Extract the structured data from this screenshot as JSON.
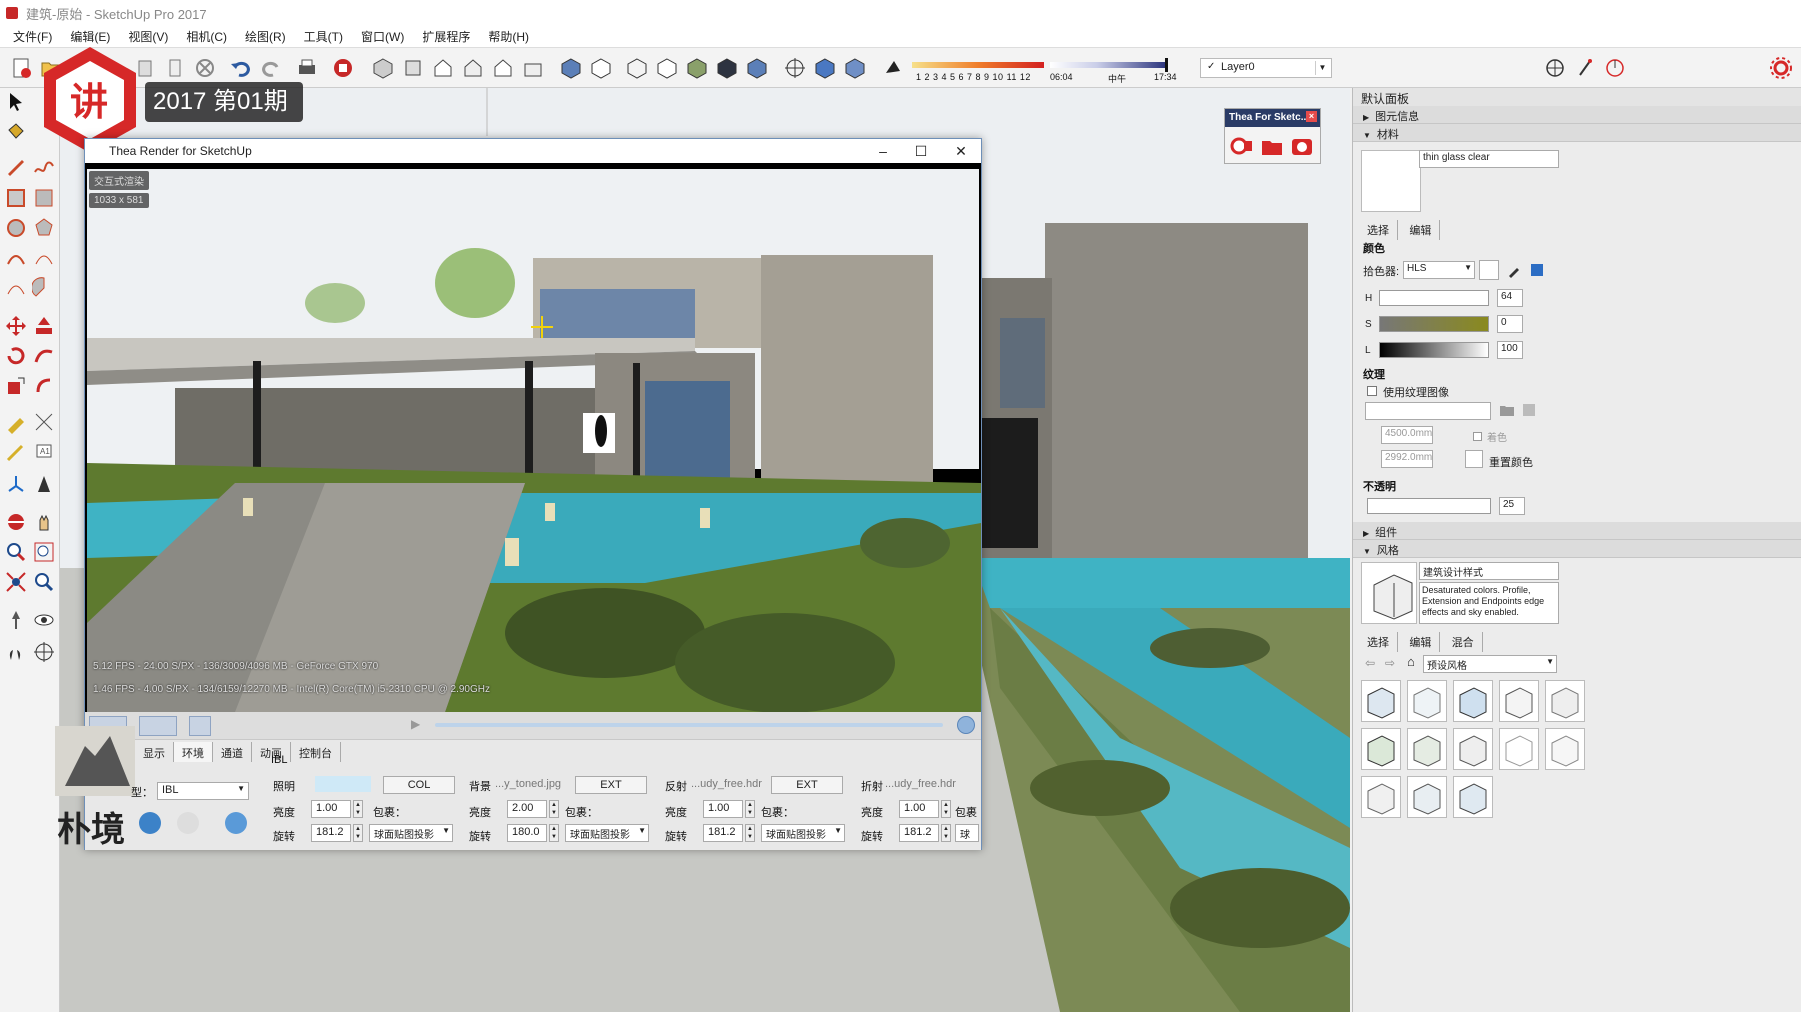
{
  "window": {
    "title": "建筑-原始 - SketchUp Pro 2017"
  },
  "menu": {
    "items": [
      "文件(F)",
      "编辑(E)",
      "视图(V)",
      "相机(C)",
      "绘图(R)",
      "工具(T)",
      "窗口(W)",
      "扩展程序",
      "帮助(H)"
    ]
  },
  "toolbar": {
    "month_numbers": "1 2 3 4 5 6 7 8 9 10 11 12",
    "time_start": "06:04",
    "time_mid": "中午",
    "time_end": "17:34",
    "layer": "Layer0"
  },
  "overlay": {
    "issue_label": "2017 第01期",
    "brand_text": "朴境"
  },
  "thea_mini": {
    "title": "Thea For Sketc..."
  },
  "thea_window": {
    "title": "Thea Render for SketchUp",
    "mode_tag": "交互式渲染",
    "resolution": "1033 x 581",
    "fps_line_1": "5.12 FPS - 24.00 S/PX - 136/3009/4096 MB - GeForce GTX 970",
    "fps_line_2": "1.46 FPS - 4.00 S/PX - 134/6159/12270 MB - Intel(R) Core(TM) i5-2310 CPU @ 2.90GHz",
    "tabs": [
      "显示",
      "环境",
      "通道",
      "动画",
      "控制台"
    ],
    "active_tab": "环境",
    "ibl": {
      "group": "IBL",
      "type_value": "IBL",
      "type_label": "型：",
      "lighting": {
        "label": "照明",
        "btn": "COL",
        "brightness_label": "亮度",
        "brightness": "1.00",
        "wrap_label": "包裹：",
        "rotation_label": "旋转",
        "rotation": "181.2",
        "projection": "球面贴图投影"
      },
      "background": {
        "label": "背景",
        "file": "...y_toned.jpg",
        "btn": "EXT",
        "brightness_label": "亮度",
        "brightness": "2.00",
        "wrap_label": "包裹：",
        "rotation_label": "旋转",
        "rotation": "180.0",
        "projection": "球面贴图投影"
      },
      "reflection": {
        "label": "反射",
        "file": "...udy_free.hdr",
        "btn": "EXT",
        "brightness_label": "亮度",
        "brightness": "1.00",
        "wrap_label": "包裹：",
        "rotation_label": "旋转",
        "rotation": "181.2",
        "projection": "球面贴图投影"
      },
      "refraction": {
        "label": "折射",
        "file": "...udy_free.hdr",
        "brightness_label": "亮度",
        "brightness": "1.00",
        "wrap_label": "包裹",
        "rotation_label": "旋转",
        "rotation": "181.2",
        "projection": "球面"
      }
    }
  },
  "right_panel": {
    "title": "默认面板",
    "entity_info": "图元信息",
    "materials": "材料",
    "material_name": "thin glass clear",
    "mat_tabs": [
      "选择",
      "编辑"
    ],
    "color_section": "颜色",
    "picker_label": "拾色器:",
    "picker_value": "HLS",
    "h_label": "H",
    "h_value": "64",
    "s_label": "S",
    "s_value": "0",
    "l_label": "L",
    "l_value": "100",
    "texture_section": "纹理",
    "use_texture": "使用纹理图像",
    "tex_w": "4500.0mm",
    "tex_h": "2992.0mm",
    "colorize": "着色",
    "reset_color": "重置颜色",
    "opacity_section": "不透明",
    "opacity_value": "25",
    "components": "组件",
    "styles": "风格",
    "style_name": "建筑设计样式",
    "style_desc": "Desaturated colors. Profile, Extension and Endpoints edge effects and sky enabled.",
    "style_tabs": [
      "选择",
      "编辑",
      "混合"
    ],
    "style_preset": "预设风格"
  },
  "colors": {
    "accent_red": "#d62828",
    "thea_header": "#2a3b66",
    "water": "#3fb3c4",
    "grass": "#5a7a2e",
    "concrete": "#8d8a83"
  }
}
